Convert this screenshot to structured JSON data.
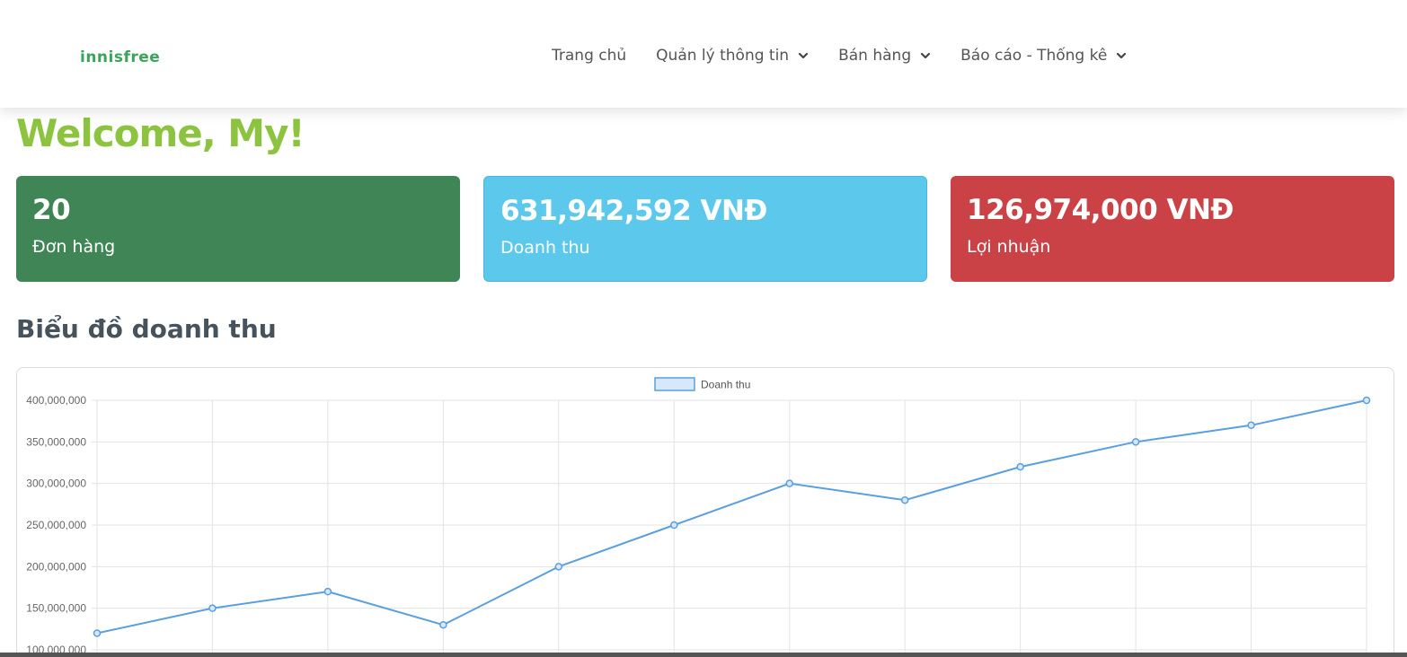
{
  "nav": {
    "logo": "innisfree",
    "items": [
      {
        "label": "Trang chủ",
        "dropdown": false
      },
      {
        "label": "Quản lý thông tin",
        "dropdown": true
      },
      {
        "label": "Bán hàng",
        "dropdown": true
      },
      {
        "label": "Báo cáo - Thống kê",
        "dropdown": true
      }
    ]
  },
  "welcome": "Welcome, My!",
  "stats": [
    {
      "value": "20",
      "label": "Đơn hàng"
    },
    {
      "value": "631,942,592 VNĐ",
      "label": "Doanh thu"
    },
    {
      "value": "126,974,000 VNĐ",
      "label": "Lợi nhuận"
    }
  ],
  "section_title": "Biểu đồ doanh thu",
  "colors": {
    "accent_green": "#8cc43f",
    "card_green": "#408556",
    "card_blue": "#5bc8ec",
    "card_red": "#ca4246",
    "line": "#5a9fe0"
  },
  "chart_data": {
    "type": "line",
    "title": "",
    "xlabel": "",
    "ylabel": "",
    "legend": "top-center",
    "grid": true,
    "ylim": [
      100000000,
      400000000
    ],
    "y_ticks": [
      "400,000,000",
      "350,000,000",
      "300,000,000",
      "250,000,000",
      "200,000,000",
      "150,000,000",
      "100,000,000"
    ],
    "series": [
      {
        "name": "Doanh thu",
        "values": [
          120000000,
          150000000,
          170000000,
          130000000,
          200000000,
          250000000,
          300000000,
          280000000,
          320000000,
          350000000,
          370000000,
          400000000
        ]
      }
    ]
  }
}
